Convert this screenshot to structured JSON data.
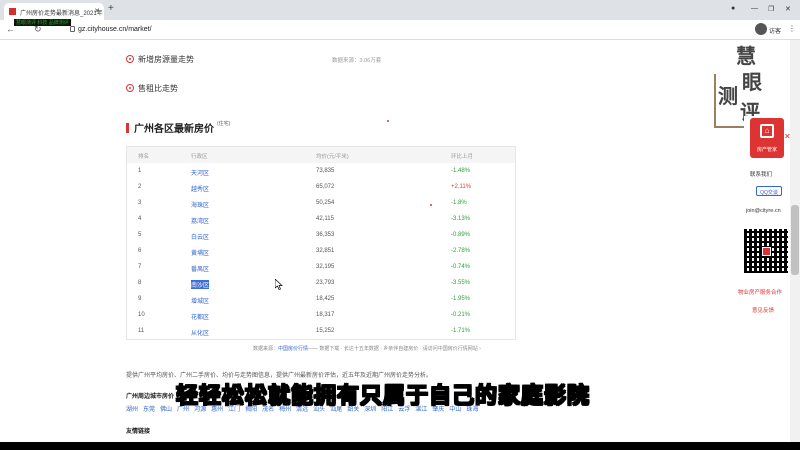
{
  "browser": {
    "tab_title": "广州房价走势最新消息_2021年",
    "url": "gz.cityhouse.cn/market/",
    "profile_label": "访客",
    "watermark_small": "慧眼测评 科技 品牌测评"
  },
  "sections": {
    "new_supply": "新增房源量走势",
    "rent_ratio": "售租比走势",
    "stat_note": "数据来源：3.06万套"
  },
  "district_table": {
    "title": "广州各区最新房价",
    "title_sup": "(住宅)",
    "headers": [
      "排名",
      "行政区",
      "均价(元/平米)",
      "环比上月"
    ],
    "rows": [
      {
        "rank": "1",
        "district": "天河区",
        "price": "73,835",
        "change": "-1.48%",
        "dir": "down"
      },
      {
        "rank": "2",
        "district": "越秀区",
        "price": "65,072",
        "change": "+2.11%",
        "dir": "up"
      },
      {
        "rank": "3",
        "district": "海珠区",
        "price": "50,254",
        "change": "-1.8%",
        "dir": "down"
      },
      {
        "rank": "4",
        "district": "荔湾区",
        "price": "42,115",
        "change": "-3.13%",
        "dir": "down"
      },
      {
        "rank": "5",
        "district": "白云区",
        "price": "36,353",
        "change": "-0.89%",
        "dir": "down"
      },
      {
        "rank": "6",
        "district": "黄埔区",
        "price": "32,851",
        "change": "-2.78%",
        "dir": "down"
      },
      {
        "rank": "7",
        "district": "番禺区",
        "price": "32,195",
        "change": "-0.74%",
        "dir": "down"
      },
      {
        "rank": "8",
        "district": "南沙区",
        "price": "23,793",
        "change": "-3.55%",
        "dir": "down",
        "selected": true
      },
      {
        "rank": "9",
        "district": "增城区",
        "price": "18,425",
        "change": "-1.95%",
        "dir": "down"
      },
      {
        "rank": "10",
        "district": "花都区",
        "price": "18,317",
        "change": "-0.21%",
        "dir": "down"
      },
      {
        "rank": "11",
        "district": "从化区",
        "price": "15,252",
        "change": "-1.71%",
        "dir": "down"
      }
    ],
    "source_prefix": "数据来源：",
    "source_link": "中国房价行情",
    "source_suffix": "—— 数据下载 · 长达十五年数据 · 乡亲伴自建房价 · 请访问中国房价行情网站 ›"
  },
  "description": "提供广州平均房价、广州二手房价、均价与走势图信息，提供广州最新房价评估，近五年及近期广州房价走势分析。",
  "nearby": {
    "title": "广州周边城市房价",
    "cities": [
      "湖州",
      "东莞",
      "佛山",
      "广州",
      "河源",
      "惠州",
      "江门",
      "揭阳",
      "茂名",
      "梅州",
      "清远",
      "汕头",
      "汕尾",
      "韶关",
      "深圳",
      "阳江",
      "云浮",
      "湛江",
      "肇庆",
      "中山",
      "珠海"
    ]
  },
  "friend_links": "友情链接",
  "overlay": {
    "stamp_chars": [
      "慧",
      "眼",
      "测",
      "评"
    ],
    "badge_label": "房产管家",
    "contact_us": "联系我们",
    "qq_label": "QQ交谈",
    "email": "join@cityre.cn",
    "partner_link": "物业房产服务合作",
    "feedback_link": "意见反馈",
    "subtitle": "轻轻松松就能拥有只属于自己的家庭影院"
  }
}
